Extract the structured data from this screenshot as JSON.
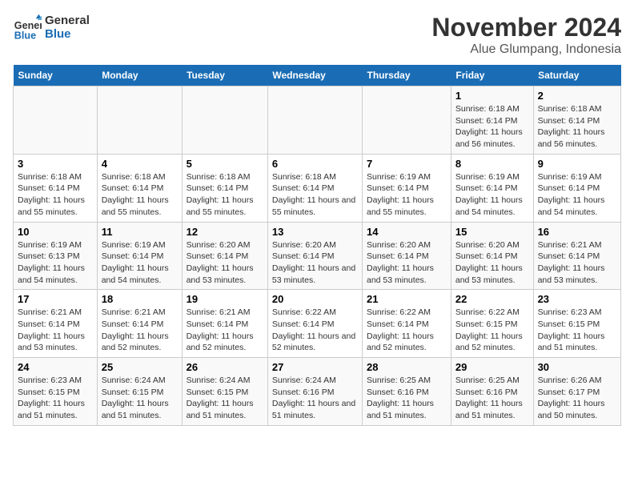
{
  "logo": {
    "text_general": "General",
    "text_blue": "Blue"
  },
  "title": "November 2024",
  "subtitle": "Alue Glumpang, Indonesia",
  "days_of_week": [
    "Sunday",
    "Monday",
    "Tuesday",
    "Wednesday",
    "Thursday",
    "Friday",
    "Saturday"
  ],
  "weeks": [
    [
      {
        "day": "",
        "info": ""
      },
      {
        "day": "",
        "info": ""
      },
      {
        "day": "",
        "info": ""
      },
      {
        "day": "",
        "info": ""
      },
      {
        "day": "",
        "info": ""
      },
      {
        "day": "1",
        "info": "Sunrise: 6:18 AM\nSunset: 6:14 PM\nDaylight: 11 hours and 56 minutes."
      },
      {
        "day": "2",
        "info": "Sunrise: 6:18 AM\nSunset: 6:14 PM\nDaylight: 11 hours and 56 minutes."
      }
    ],
    [
      {
        "day": "3",
        "info": "Sunrise: 6:18 AM\nSunset: 6:14 PM\nDaylight: 11 hours and 55 minutes."
      },
      {
        "day": "4",
        "info": "Sunrise: 6:18 AM\nSunset: 6:14 PM\nDaylight: 11 hours and 55 minutes."
      },
      {
        "day": "5",
        "info": "Sunrise: 6:18 AM\nSunset: 6:14 PM\nDaylight: 11 hours and 55 minutes."
      },
      {
        "day": "6",
        "info": "Sunrise: 6:18 AM\nSunset: 6:14 PM\nDaylight: 11 hours and 55 minutes."
      },
      {
        "day": "7",
        "info": "Sunrise: 6:19 AM\nSunset: 6:14 PM\nDaylight: 11 hours and 55 minutes."
      },
      {
        "day": "8",
        "info": "Sunrise: 6:19 AM\nSunset: 6:14 PM\nDaylight: 11 hours and 54 minutes."
      },
      {
        "day": "9",
        "info": "Sunrise: 6:19 AM\nSunset: 6:14 PM\nDaylight: 11 hours and 54 minutes."
      }
    ],
    [
      {
        "day": "10",
        "info": "Sunrise: 6:19 AM\nSunset: 6:13 PM\nDaylight: 11 hours and 54 minutes."
      },
      {
        "day": "11",
        "info": "Sunrise: 6:19 AM\nSunset: 6:14 PM\nDaylight: 11 hours and 54 minutes."
      },
      {
        "day": "12",
        "info": "Sunrise: 6:20 AM\nSunset: 6:14 PM\nDaylight: 11 hours and 53 minutes."
      },
      {
        "day": "13",
        "info": "Sunrise: 6:20 AM\nSunset: 6:14 PM\nDaylight: 11 hours and 53 minutes."
      },
      {
        "day": "14",
        "info": "Sunrise: 6:20 AM\nSunset: 6:14 PM\nDaylight: 11 hours and 53 minutes."
      },
      {
        "day": "15",
        "info": "Sunrise: 6:20 AM\nSunset: 6:14 PM\nDaylight: 11 hours and 53 minutes."
      },
      {
        "day": "16",
        "info": "Sunrise: 6:21 AM\nSunset: 6:14 PM\nDaylight: 11 hours and 53 minutes."
      }
    ],
    [
      {
        "day": "17",
        "info": "Sunrise: 6:21 AM\nSunset: 6:14 PM\nDaylight: 11 hours and 53 minutes."
      },
      {
        "day": "18",
        "info": "Sunrise: 6:21 AM\nSunset: 6:14 PM\nDaylight: 11 hours and 52 minutes."
      },
      {
        "day": "19",
        "info": "Sunrise: 6:21 AM\nSunset: 6:14 PM\nDaylight: 11 hours and 52 minutes."
      },
      {
        "day": "20",
        "info": "Sunrise: 6:22 AM\nSunset: 6:14 PM\nDaylight: 11 hours and 52 minutes."
      },
      {
        "day": "21",
        "info": "Sunrise: 6:22 AM\nSunset: 6:14 PM\nDaylight: 11 hours and 52 minutes."
      },
      {
        "day": "22",
        "info": "Sunrise: 6:22 AM\nSunset: 6:15 PM\nDaylight: 11 hours and 52 minutes."
      },
      {
        "day": "23",
        "info": "Sunrise: 6:23 AM\nSunset: 6:15 PM\nDaylight: 11 hours and 51 minutes."
      }
    ],
    [
      {
        "day": "24",
        "info": "Sunrise: 6:23 AM\nSunset: 6:15 PM\nDaylight: 11 hours and 51 minutes."
      },
      {
        "day": "25",
        "info": "Sunrise: 6:24 AM\nSunset: 6:15 PM\nDaylight: 11 hours and 51 minutes."
      },
      {
        "day": "26",
        "info": "Sunrise: 6:24 AM\nSunset: 6:15 PM\nDaylight: 11 hours and 51 minutes."
      },
      {
        "day": "27",
        "info": "Sunrise: 6:24 AM\nSunset: 6:16 PM\nDaylight: 11 hours and 51 minutes."
      },
      {
        "day": "28",
        "info": "Sunrise: 6:25 AM\nSunset: 6:16 PM\nDaylight: 11 hours and 51 minutes."
      },
      {
        "day": "29",
        "info": "Sunrise: 6:25 AM\nSunset: 6:16 PM\nDaylight: 11 hours and 51 minutes."
      },
      {
        "day": "30",
        "info": "Sunrise: 6:26 AM\nSunset: 6:17 PM\nDaylight: 11 hours and 50 minutes."
      }
    ]
  ]
}
